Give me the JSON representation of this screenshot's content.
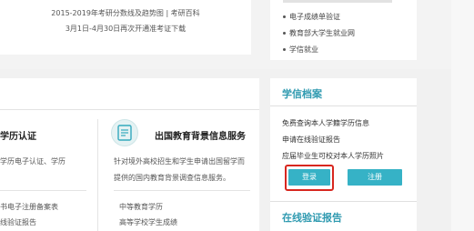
{
  "top": {
    "line1": "2015-2019年考研分数线及趋势图 | 考研百科",
    "line2": "3月1日-4月30日再次开通准考证下载",
    "links": [
      "电子成绩单验证",
      "教育部大学生就业网",
      "学信就业"
    ]
  },
  "mid": {
    "left_title": "学历认证",
    "left_desc": "学历电子认证、学历",
    "left_item1": "书电子注册备案表",
    "left_item2": "线验证报告",
    "edu_title": "出国教育背景信息服务",
    "edu_desc1": "针对境外高校招生和学生申请出国留学而",
    "edu_desc2": "提供的国内教育背景调查信息服务。",
    "edu_item1": "中等教育学历",
    "edu_item2": "高等学校学生成绩"
  },
  "archive": {
    "title": "学信档案",
    "line1": "免费查询本人学籍学历信息",
    "line2": "申请在线验证报告",
    "line3": "应届毕业生可校对本人学历照片",
    "login_label": "登录",
    "register_label": "注册"
  },
  "online": {
    "title": "在线验证报告"
  },
  "colors": {
    "accent": "#36b2c6",
    "title_blue": "#2f9ab0",
    "highlight_red": "#d8271f"
  }
}
